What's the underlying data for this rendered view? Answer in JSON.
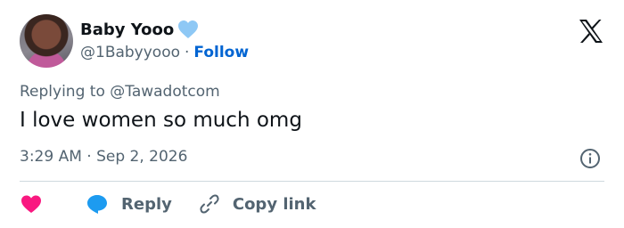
{
  "user": {
    "name": "Baby Yooo",
    "handle": "@1Babyyooo",
    "separator": "·",
    "follow_label": "Follow",
    "name_emoji": "light-blue-heart-icon",
    "avatar": "profile-photo"
  },
  "brand": {
    "logo": "x-logo-icon"
  },
  "tweet": {
    "replying_to": "Replying to @Tawadotcom",
    "text": "I love women so much omg",
    "timestamp": "3:29 AM · Sep 2, 2026"
  },
  "actions": {
    "like_icon": "heart-icon",
    "reply_label": "Reply",
    "reply_icon": "speech-bubble-icon",
    "copy_label": "Copy link",
    "copy_icon": "link-icon",
    "info_icon": "info-icon"
  },
  "colors": {
    "text": "#0f1419",
    "secondary": "#536471",
    "follow": "#0064d2",
    "like": "#f91880",
    "reply_bubble": "#1d9bf0",
    "heart_emoji": "#8ec8f5",
    "divider": "#cfd9de"
  }
}
